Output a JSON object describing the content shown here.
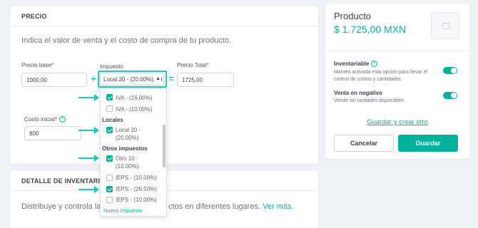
{
  "precio": {
    "section_title": "PRECIO",
    "description": "Indica el valor de venta y el costo de compra de tu producto.",
    "precio_base_label": "Precio base",
    "precio_base_value": "1000.00",
    "impuesto_label": "Impuesto",
    "impuesto_value": "Local 20 - (20.00%), Ot",
    "precio_total_label": "Precio Total",
    "precio_total_value": "1725.00",
    "costo_label": "Costo inicial",
    "costo_value": "800",
    "plus": "+",
    "equals": "=",
    "required_mark": "*",
    "caret": "▲"
  },
  "dropdown": {
    "iva_16": "IVA - (16.00%)",
    "iva_10": "IVA - (10.00%)",
    "group_locales": "Locales",
    "local_20_line1": "Local 20 -",
    "local_20_line2": "(20.00%)",
    "group_otros": "Otros impuestos",
    "otro_10_line1": "Otro 10 -",
    "otro_10_line2": "(10.00%)",
    "ieps_10": "IEPS - (10.00%)",
    "ieps_26": "IEPS - (26.50%)",
    "ieps_10b": "IEPS - (10.00%)",
    "new_tax": "Nuevo Impuesto"
  },
  "inventario": {
    "section_title": "DETALLE DE INVENTARIO",
    "description_start": "Distribuye y controla las ca",
    "description_end": "ctos en diferentes lugares.",
    "link": "Ver más."
  },
  "producto": {
    "title": "Producto",
    "price": "$ 1.725,00 MXN",
    "inventariable_title": "Inventariable",
    "inventariable_desc": "Mantén activada esta opción para llevar el control de costos y cantidades",
    "inventariable_on": true,
    "venta_negativo_title": "Venta en negativo",
    "venta_negativo_desc": "Vende sin unidades disponibles",
    "venta_negativo_on": true,
    "save_create_link": "Guardar y crear otro",
    "cancel_label": "Cancelar",
    "save_label": "Guardar"
  },
  "icons": {
    "help": "?",
    "image_placeholder": "image-icon"
  },
  "colors": {
    "accent": "#00b19d",
    "highlight": "#1ec8b5",
    "required": "#e0314b"
  }
}
